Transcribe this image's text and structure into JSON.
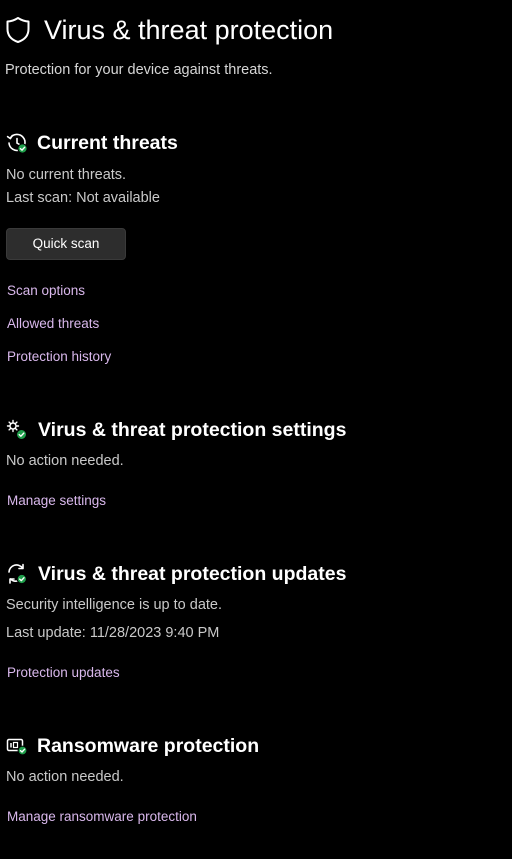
{
  "header": {
    "title": "Virus & threat protection",
    "subtitle": "Protection for your device against threats.",
    "icon": "shield-icon"
  },
  "current_threats": {
    "title": "Current threats",
    "icon": "history-check-icon",
    "status": "No current threats.",
    "last_scan": "Last scan: Not available",
    "quick_scan_label": "Quick scan",
    "links": [
      "Scan options",
      "Allowed threats",
      "Protection history"
    ]
  },
  "protection_settings": {
    "title": "Virus & threat protection settings",
    "icon": "settings-gears-icon",
    "status": "No action needed.",
    "link": "Manage settings"
  },
  "protection_updates": {
    "title": "Virus & threat protection updates",
    "icon": "refresh-check-icon",
    "status": "Security intelligence is up to date.",
    "last_update": "Last update: 11/28/2023 9:40 PM",
    "link": "Protection updates"
  },
  "ransomware": {
    "title": "Ransomware protection",
    "icon": "ransomware-folder-icon",
    "status": "No action needed.",
    "link": "Manage ransomware protection"
  },
  "colors": {
    "background": "#000000",
    "link": "#d9b8ec",
    "status_check": "#1e9e4a",
    "button_bg": "#2d2d2d"
  }
}
